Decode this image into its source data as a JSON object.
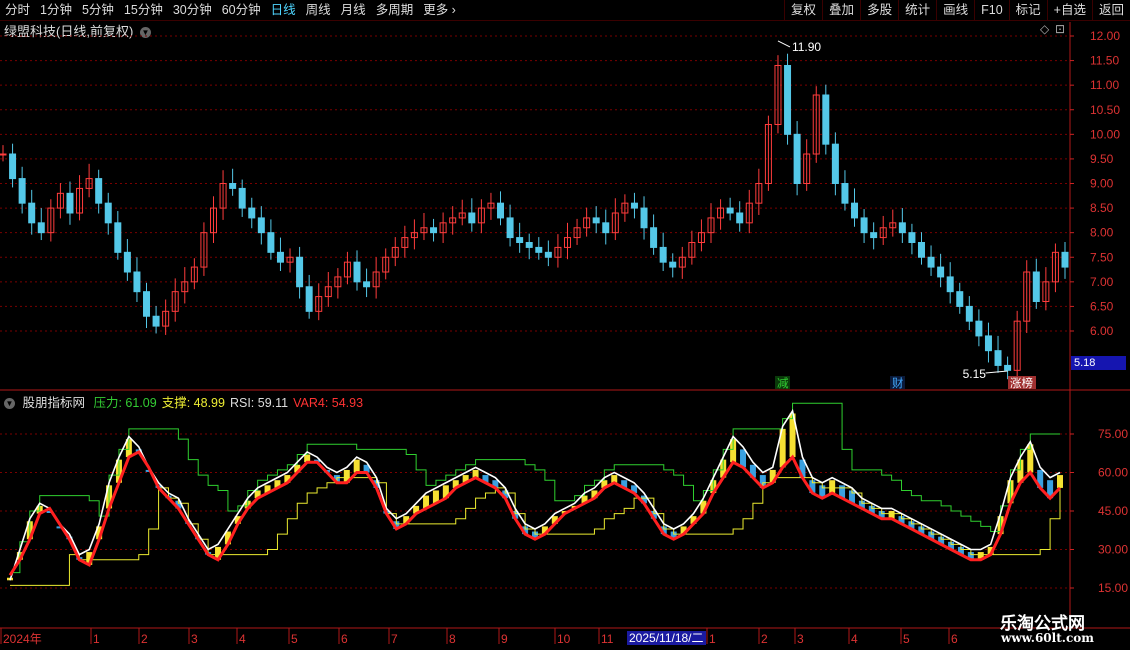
{
  "toolbar": {
    "tabs": [
      "分时",
      "1分钟",
      "5分钟",
      "15分钟",
      "30分钟",
      "60分钟",
      "日线",
      "周线",
      "月线",
      "多周期",
      "更多"
    ],
    "active_tab": "日线",
    "right_buttons": [
      "复权",
      "叠加",
      "多股",
      "统计",
      "画线",
      "F10",
      "标记",
      "+自选",
      "返回"
    ]
  },
  "main_chart": {
    "title": "绿盟科技(日线,前复权)",
    "high_marker": "11.90",
    "low_marker": "5.15",
    "current_price": "5.18",
    "axis_ticks": [
      "12.00",
      "11.50",
      "11.00",
      "10.50",
      "10.00",
      "9.50",
      "9.00",
      "8.50",
      "8.00",
      "7.50",
      "7.00",
      "6.50",
      "6.00"
    ],
    "events": [
      {
        "label": "减",
        "color": "#3c3",
        "bg": "#0a3a0a"
      },
      {
        "label": "财",
        "color": "#4af",
        "bg": "#0a1a3a"
      },
      {
        "label": "涨榜",
        "color": "#fff",
        "bg": "#a03030"
      }
    ]
  },
  "indicator": {
    "name": "股朋指标网",
    "values": [
      {
        "label": "压力:",
        "value": "61.09",
        "color": "#3c3"
      },
      {
        "label": "支撑:",
        "value": "48.99",
        "color": "#ee3"
      },
      {
        "label": "RSI:",
        "value": "59.11",
        "color": "#ddd"
      },
      {
        "label": "VAR4:",
        "value": "54.93",
        "color": "#f33"
      }
    ],
    "axis_ticks": [
      "75.00",
      "60.00",
      "45.00",
      "30.00",
      "15.00"
    ]
  },
  "timeline": {
    "labels": [
      "2024年",
      "1",
      "2",
      "3",
      "4",
      "5",
      "6",
      "7",
      "8",
      "9",
      "10",
      "11",
      "1",
      "2",
      "3",
      "4",
      "5",
      "6"
    ],
    "cursor_date": "2025/11/18/二"
  },
  "watermark": {
    "title": "乐淘公式网",
    "url": "www.60lt.com"
  },
  "colors": {
    "up": "#ff3c3c",
    "down": "#54c8e8",
    "grid": "#7a0000",
    "axis": "#cc2222"
  },
  "chart_data": {
    "type": "line",
    "series": [
      {
        "name": "RSI",
        "values": [
          18,
          30,
          42,
          48,
          46,
          40,
          36,
          28,
          30,
          40,
          56,
          66,
          74,
          70,
          62,
          56,
          52,
          50,
          42,
          36,
          30,
          32,
          38,
          44,
          50,
          54,
          56,
          58,
          60,
          64,
          68,
          66,
          62,
          60,
          62,
          66,
          64,
          58,
          46,
          42,
          44,
          48,
          52,
          54,
          56,
          58,
          60,
          62,
          60,
          58,
          54,
          46,
          40,
          38,
          40,
          44,
          46,
          48,
          52,
          54,
          58,
          60,
          58,
          56,
          52,
          46,
          40,
          38,
          40,
          44,
          50,
          58,
          66,
          74,
          70,
          64,
          60,
          62,
          78,
          84,
          66,
          58,
          56,
          58,
          56,
          54,
          50,
          48,
          46,
          46,
          44,
          42,
          40,
          38,
          36,
          34,
          32,
          30,
          30,
          32,
          44,
          58,
          66,
          72,
          62,
          58,
          60
        ]
      },
      {
        "name": "VAR4",
        "values": [
          20,
          26,
          34,
          44,
          46,
          40,
          34,
          26,
          24,
          34,
          46,
          56,
          66,
          68,
          62,
          54,
          50,
          46,
          40,
          34,
          28,
          26,
          32,
          40,
          46,
          50,
          52,
          54,
          56,
          60,
          64,
          64,
          60,
          56,
          56,
          60,
          60,
          54,
          44,
          38,
          40,
          44,
          46,
          48,
          50,
          54,
          56,
          58,
          56,
          54,
          50,
          42,
          36,
          34,
          36,
          40,
          44,
          46,
          48,
          50,
          54,
          56,
          54,
          52,
          48,
          42,
          36,
          34,
          36,
          40,
          44,
          52,
          58,
          64,
          62,
          58,
          54,
          56,
          62,
          66,
          58,
          52,
          50,
          52,
          50,
          48,
          46,
          44,
          42,
          42,
          40,
          38,
          36,
          34,
          32,
          30,
          28,
          26,
          26,
          28,
          36,
          48,
          56,
          60,
          54,
          50,
          54
        ]
      }
    ],
    "ylim": [
      15,
      80
    ]
  }
}
